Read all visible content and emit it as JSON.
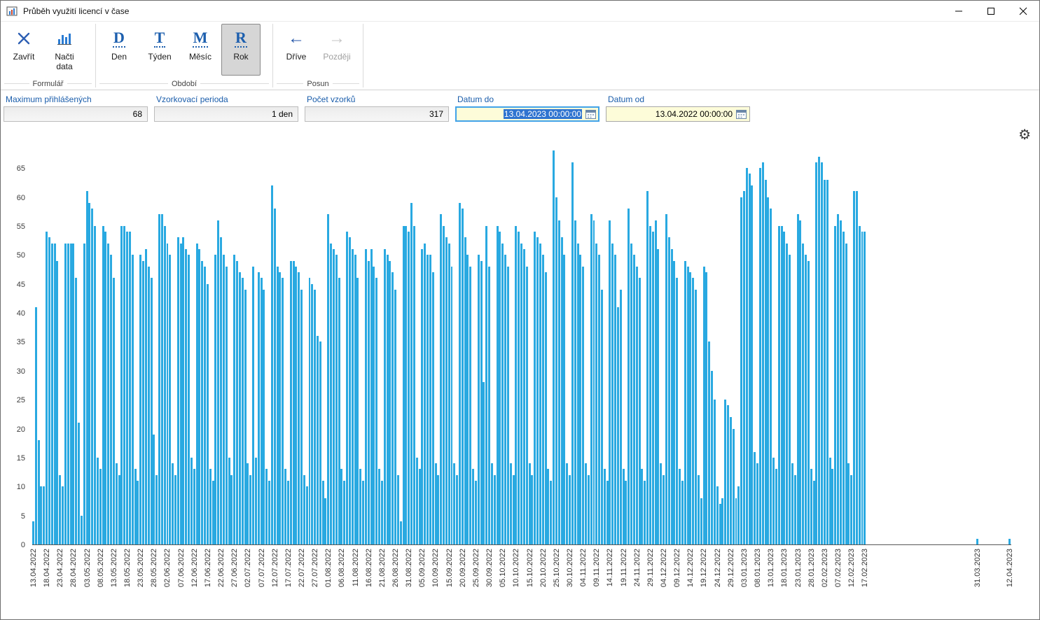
{
  "window": {
    "title": "Průběh využití licencí v čase"
  },
  "icons": {
    "app": "mini-bar-chart",
    "close_form": "blue-x",
    "load_data": "bar-chart",
    "earlier": "←",
    "later": "→",
    "calendar": "calendar-grid",
    "settings": "⚙",
    "minimize": "–",
    "maximize": "□",
    "close_window": "✕"
  },
  "toolbar": {
    "groups": [
      {
        "label": "Formulář",
        "buttons": [
          {
            "label": "Zavřít",
            "icon": "blue-x"
          },
          {
            "label": "Načti data",
            "icon": "bar-chart"
          }
        ]
      },
      {
        "label": "Období",
        "buttons": [
          {
            "label": "Den",
            "glyph": "D",
            "selected": false
          },
          {
            "label": "Týden",
            "glyph": "T",
            "selected": false
          },
          {
            "label": "Měsíc",
            "glyph": "M",
            "selected": false
          },
          {
            "label": "Rok",
            "glyph": "R",
            "selected": true
          }
        ]
      },
      {
        "label": "Posun",
        "buttons": [
          {
            "label": "Dříve",
            "icon": "arrow-left",
            "disabled": false
          },
          {
            "label": "Později",
            "icon": "arrow-right",
            "disabled": true
          }
        ]
      }
    ]
  },
  "fields": [
    {
      "label": "Maximum přihlášených",
      "value": "68",
      "readonly": true
    },
    {
      "label": "Vzorkovací perioda",
      "value": "1 den",
      "readonly": true
    },
    {
      "label": "Počet vzorků",
      "value": "317",
      "readonly": true
    },
    {
      "label": "Datum do",
      "value": "13.04.2023 00:00:00",
      "editable": true,
      "focused": true,
      "text_selected": true,
      "icon": "calendar-grid"
    },
    {
      "label": "Datum od",
      "value": "13.04.2022 00:00:00",
      "editable": true,
      "focused": false,
      "text_selected": false,
      "icon": "calendar-grid"
    }
  ],
  "colors": {
    "bar": "#29a9e1",
    "label_blue": "#1a5dab",
    "field_yellow": "#fdfcd9",
    "selection_blue": "#2f74d0"
  },
  "chart_data": {
    "type": "bar",
    "title": "",
    "xlabel": "",
    "ylabel": "",
    "grid": false,
    "legend": "none",
    "ylim": [
      0,
      69
    ],
    "yticks": [
      0,
      5,
      10,
      15,
      20,
      25,
      30,
      35,
      40,
      45,
      50,
      55,
      60,
      65
    ],
    "bar_color": "#29a9e1",
    "start_date": "13.04.2022",
    "end_date": "12.04.2023",
    "total_days": 365,
    "sampling_period_days": 1,
    "x_tick_every_days": 5,
    "x_tick_labels": [
      "13.04.2022",
      "18.04.2022",
      "23.04.2022",
      "28.04.2022",
      "03.05.2022",
      "08.05.2022",
      "13.05.2022",
      "18.05.2022",
      "23.05.2022",
      "28.05.2022",
      "02.06.2022",
      "07.06.2022",
      "12.06.2022",
      "17.06.2022",
      "22.06.2022",
      "27.06.2022",
      "02.07.2022",
      "07.07.2022",
      "12.07.2022",
      "17.07.2022",
      "22.07.2022",
      "27.07.2022",
      "01.08.2022",
      "06.08.2022",
      "11.08.2022",
      "16.08.2022",
      "21.08.2022",
      "26.08.2022",
      "31.08.2022",
      "05.09.2022",
      "10.09.2022",
      "15.09.2022",
      "20.09.2022",
      "25.09.2022",
      "30.09.2022",
      "05.10.2022",
      "10.10.2022",
      "15.10.2022",
      "20.10.2022",
      "25.10.2022",
      "30.10.2022",
      "04.11.2022",
      "09.11.2022",
      "14.11.2022",
      "19.11.2022",
      "24.11.2022",
      "29.11.2022",
      "04.12.2022",
      "09.12.2022",
      "14.12.2022",
      "19.12.2022",
      "24.12.2022",
      "29.12.2022",
      "03.01.2023",
      "08.01.2023",
      "13.01.2023",
      "18.01.2023",
      "23.01.2023",
      "28.01.2023",
      "02.02.2023",
      "07.02.2023",
      "12.02.2023",
      "17.02.2023"
    ],
    "values": [
      4,
      41,
      18,
      10,
      10,
      54,
      53,
      52,
      52,
      49,
      12,
      10,
      52,
      52,
      52,
      52,
      46,
      21,
      5,
      52,
      61,
      59,
      58,
      55,
      15,
      13,
      55,
      54,
      52,
      50,
      46,
      14,
      12,
      55,
      55,
      54,
      54,
      50,
      13,
      11,
      50,
      49,
      51,
      48,
      46,
      19,
      12,
      57,
      57,
      55,
      52,
      50,
      14,
      12,
      53,
      52,
      53,
      51,
      50,
      15,
      13,
      52,
      51,
      49,
      48,
      45,
      13,
      11,
      50,
      56,
      53,
      50,
      48,
      15,
      12,
      50,
      49,
      47,
      46,
      44,
      14,
      12,
      48,
      15,
      47,
      46,
      44,
      13,
      11,
      62,
      58,
      48,
      47,
      46,
      13,
      11,
      49,
      49,
      48,
      47,
      44,
      12,
      10,
      46,
      45,
      44,
      36,
      35,
      11,
      8,
      57,
      52,
      51,
      50,
      46,
      13,
      11,
      54,
      53,
      51,
      50,
      46,
      13,
      11,
      51,
      49,
      51,
      48,
      46,
      13,
      11,
      51,
      50,
      49,
      47,
      44,
      12,
      4,
      55,
      55,
      54,
      59,
      55,
      15,
      13,
      51,
      52,
      50,
      50,
      47,
      14,
      12,
      57,
      55,
      53,
      52,
      48,
      14,
      12,
      59,
      58,
      53,
      50,
      48,
      13,
      11,
      50,
      49,
      28,
      55,
      48,
      14,
      12,
      55,
      54,
      52,
      50,
      48,
      14,
      12,
      55,
      54,
      52,
      51,
      48,
      14,
      12,
      54,
      53,
      52,
      50,
      47,
      13,
      11,
      68,
      60,
      56,
      53,
      50,
      14,
      12,
      66,
      56,
      52,
      50,
      48,
      14,
      12,
      57,
      56,
      52,
      50,
      44,
      13,
      11,
      56,
      52,
      50,
      41,
      44,
      13,
      11,
      58,
      52,
      50,
      48,
      46,
      13,
      11,
      61,
      55,
      54,
      56,
      51,
      14,
      12,
      57,
      53,
      51,
      49,
      46,
      13,
      11,
      49,
      48,
      47,
      46,
      44,
      12,
      8,
      48,
      47,
      35,
      30,
      25,
      10,
      7,
      8,
      25,
      24,
      22,
      20,
      8,
      10,
      60,
      61,
      65,
      64,
      62,
      16,
      14,
      65,
      66,
      63,
      60,
      58,
      15,
      13,
      55,
      55,
      54,
      52,
      50,
      14,
      12,
      57,
      56,
      52,
      50,
      49,
      13,
      11,
      66,
      67,
      66,
      63,
      63,
      15,
      13,
      55,
      57,
      56,
      54,
      52,
      14,
      12,
      61,
      61,
      55,
      54,
      54
    ],
    "extra_points": [
      {
        "label": "31.03.2023",
        "day_offset": 352,
        "value": 1
      },
      {
        "label": "12.04.2023",
        "day_offset": 364,
        "value": 1
      }
    ]
  }
}
